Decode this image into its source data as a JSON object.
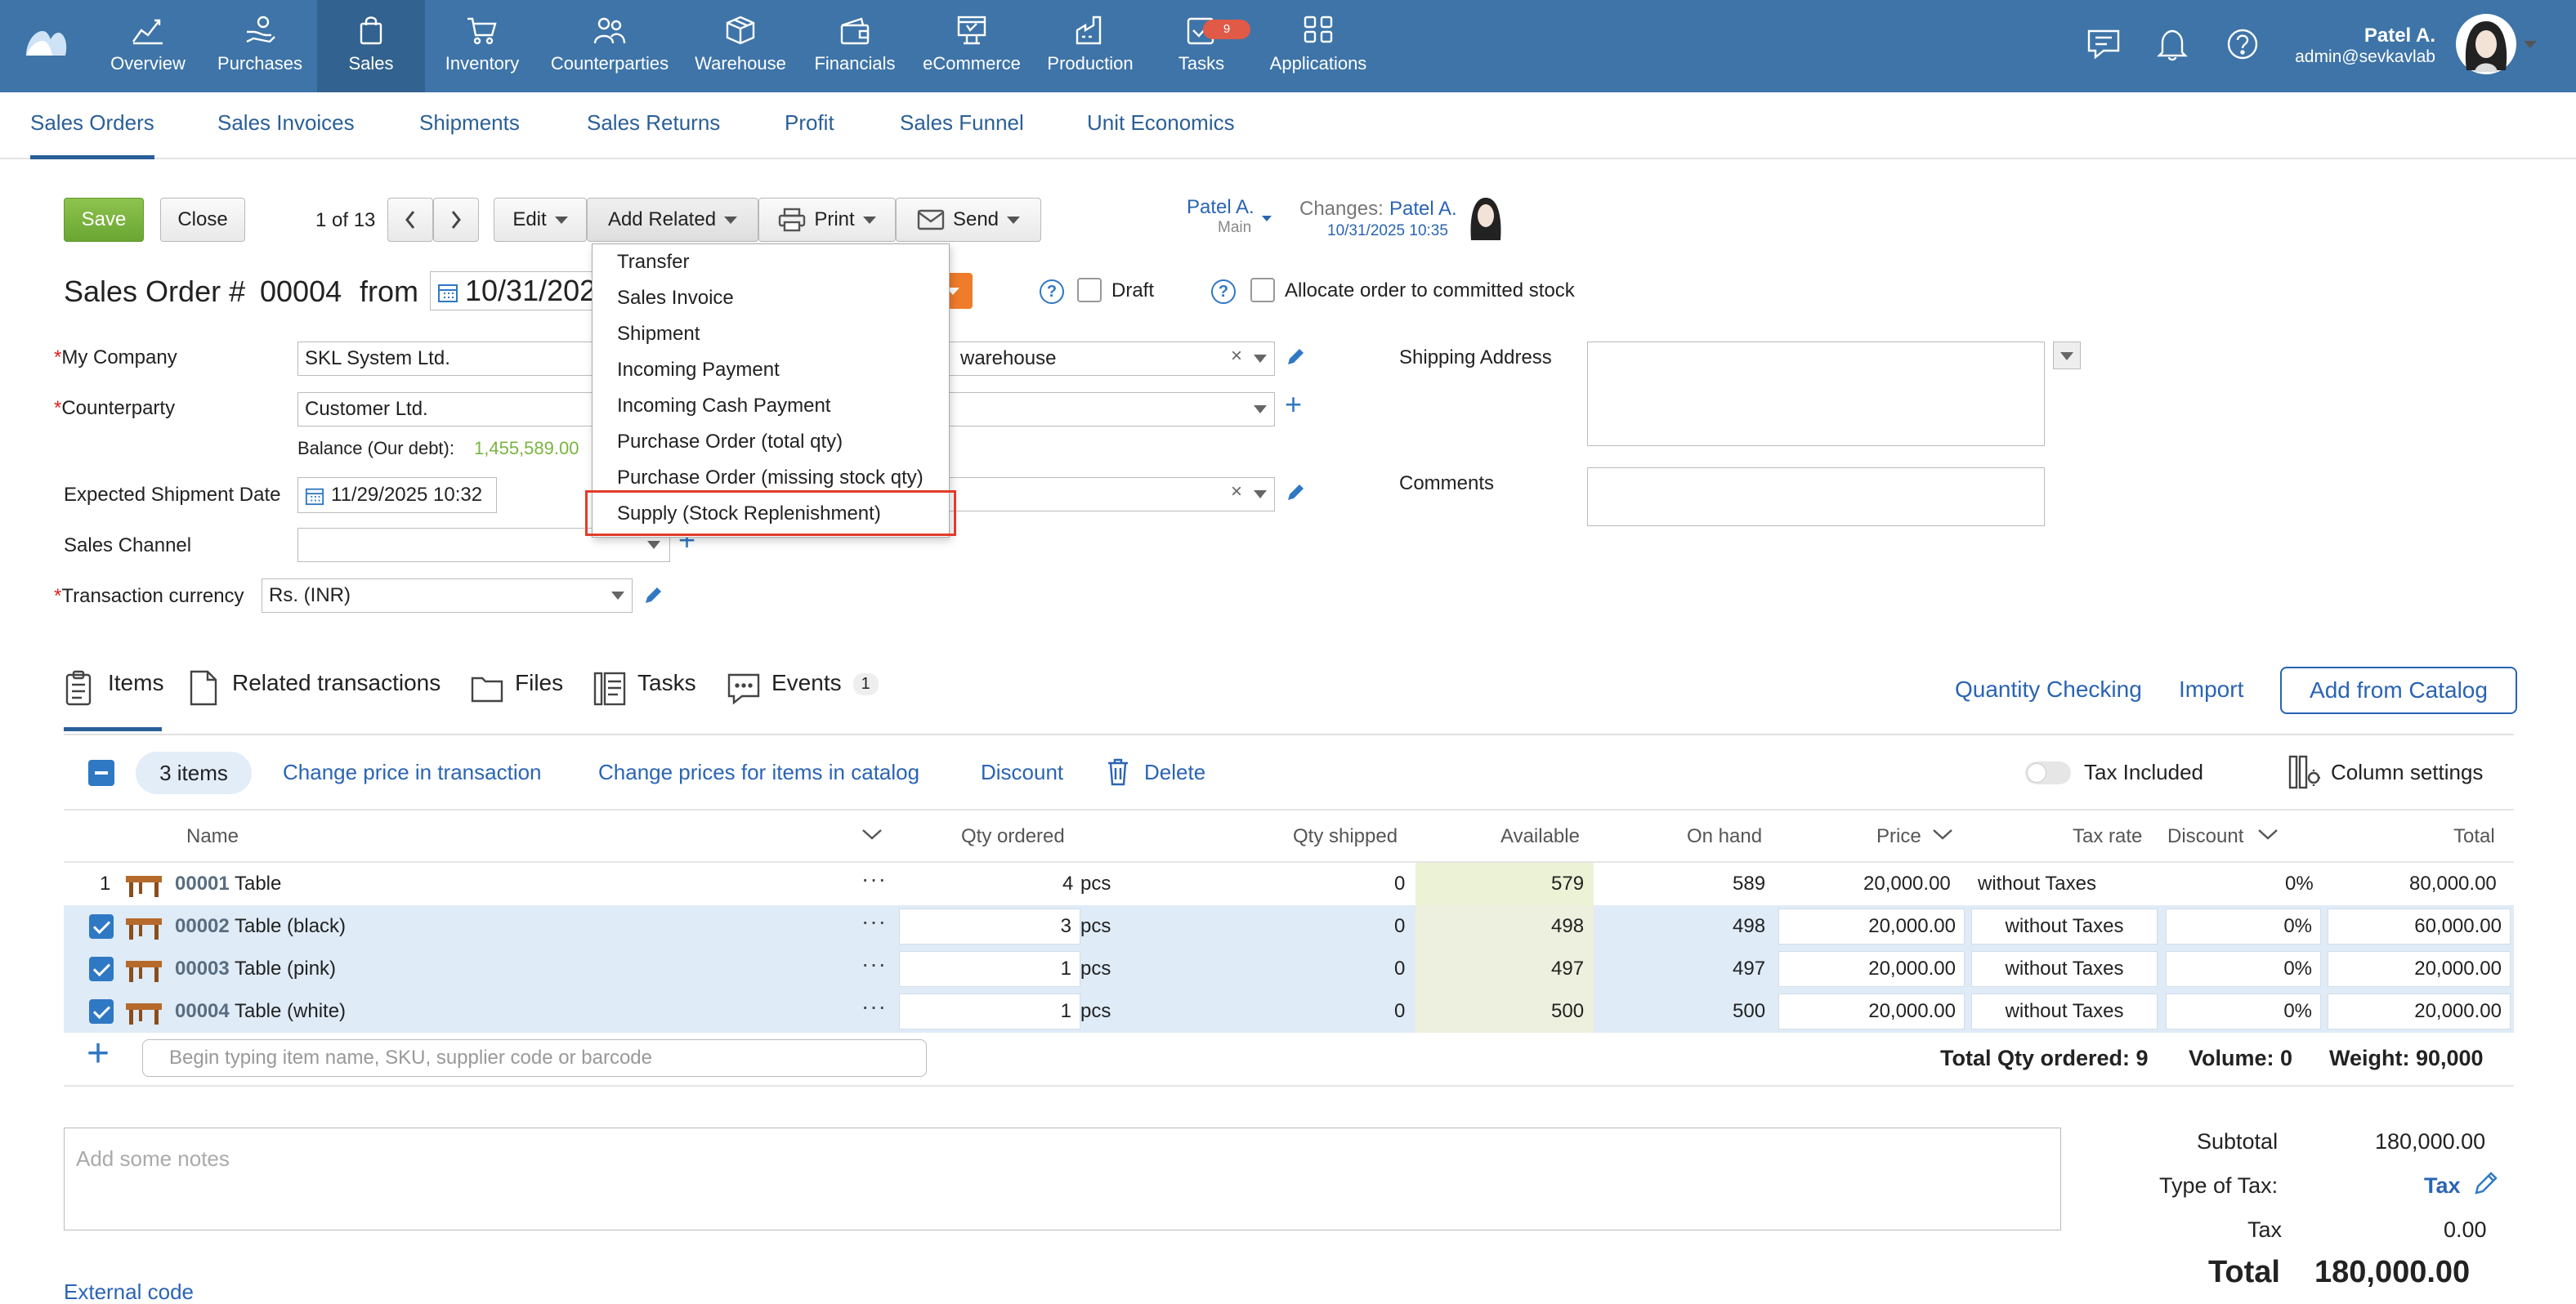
{
  "nav": {
    "items": [
      {
        "label": "Overview",
        "icon": "chart-line-icon"
      },
      {
        "label": "Purchases",
        "icon": "hand-money-icon"
      },
      {
        "label": "Sales",
        "icon": "shopping-bag-icon"
      },
      {
        "label": "Inventory",
        "icon": "cart-icon"
      },
      {
        "label": "Counterparties",
        "icon": "people-icon"
      },
      {
        "label": "Warehouse",
        "icon": "box-icon"
      },
      {
        "label": "Financials",
        "icon": "wallet-icon"
      },
      {
        "label": "eCommerce",
        "icon": "storefront-icon"
      },
      {
        "label": "Production",
        "icon": "factory-icon"
      },
      {
        "label": "Tasks",
        "icon": "checkmark-icon"
      },
      {
        "label": "Applications",
        "icon": "apps-grid-icon"
      }
    ],
    "tasks_badge": "9",
    "user_name": "Patel A.",
    "user_email": "admin@sevkavlab"
  },
  "subnav": {
    "tabs": [
      "Sales Orders",
      "Sales Invoices",
      "Shipments",
      "Sales Returns",
      "Profit",
      "Sales Funnel",
      "Unit Economics"
    ]
  },
  "toolbar": {
    "save": "Save",
    "close": "Close",
    "pager": "1 of 13",
    "edit": "Edit",
    "add_related": "Add Related",
    "print": "Print",
    "send": "Send",
    "owner": "Patel A.",
    "owner_sub": "Main",
    "changes_label": "Changes:",
    "changes_user": "Patel A.",
    "changes_date": "10/31/2025 10:35"
  },
  "menu": {
    "items": [
      "Transfer",
      "Sales Invoice",
      "Shipment",
      "Incoming Payment",
      "Incoming Cash Payment",
      "Purchase Order (total qty)",
      "Purchase Order (missing stock qty)",
      "Supply (Stock Replenishment)"
    ]
  },
  "header": {
    "title_prefix": "Sales Order #",
    "number": "00004",
    "from": "from",
    "date": "10/31/202",
    "draft": "Draft",
    "allocate": "Allocate order to committed stock"
  },
  "form": {
    "my_company_label": "My Company",
    "my_company": "SKL System Ltd.",
    "counterparty_label": "Counterparty",
    "counterparty": "Customer Ltd.",
    "balance_label": "Balance (Our debt):",
    "balance_value": "1,455,589.00",
    "warehouse": "warehouse",
    "exp_ship_label": "Expected Shipment Date",
    "exp_ship": "11/29/2025 10:32",
    "sales_channel_label": "Sales Channel",
    "currency_label": "Transaction currency",
    "currency": "Rs. (INR)",
    "shipping_label": "Shipping Address",
    "comments_label": "Comments"
  },
  "tabs": {
    "items": "Items",
    "related": "Related transactions",
    "files": "Files",
    "tasks": "Tasks",
    "events": "Events",
    "events_count": "1",
    "qty_check": "Quantity Checking",
    "import": "Import",
    "add_catalog": "Add from Catalog"
  },
  "actions": {
    "count": "3 items",
    "change_price": "Change price in transaction",
    "change_catalog": "Change prices for items in catalog",
    "discount": "Discount",
    "delete": "Delete",
    "tax_included": "Tax Included",
    "column_settings": "Column settings"
  },
  "columns": [
    "Name",
    "Qty ordered",
    "Qty shipped",
    "Available",
    "On hand",
    "Price",
    "Tax rate",
    "Discount",
    "Total"
  ],
  "rows": [
    {
      "n": "1",
      "code": "00001",
      "name": "Table",
      "qty": "4",
      "unit": "pcs",
      "shipped": "0",
      "available": "579",
      "onhand": "589",
      "price": "20,000.00",
      "tax": "without Taxes",
      "discount": "0%",
      "total": "80,000.00"
    },
    {
      "n": "",
      "code": "00002",
      "name": "Table (black)",
      "qty": "3",
      "unit": "pcs",
      "shipped": "0",
      "available": "498",
      "onhand": "498",
      "price": "20,000.00",
      "tax": "without Taxes",
      "discount": "0%",
      "total": "60,000.00"
    },
    {
      "n": "",
      "code": "00003",
      "name": "Table (pink)",
      "qty": "1",
      "unit": "pcs",
      "shipped": "0",
      "available": "497",
      "onhand": "497",
      "price": "20,000.00",
      "tax": "without Taxes",
      "discount": "0%",
      "total": "20,000.00"
    },
    {
      "n": "",
      "code": "00004",
      "name": "Table (white)",
      "qty": "1",
      "unit": "pcs",
      "shipped": "0",
      "available": "500",
      "onhand": "500",
      "price": "20,000.00",
      "tax": "without Taxes",
      "discount": "0%",
      "total": "20,000.00"
    }
  ],
  "add_item_placeholder": "Begin typing item name, SKU, supplier code or barcode",
  "totals_bar": {
    "qty": "Total Qty ordered: 9",
    "volume": "Volume: 0",
    "weight": "Weight: 90,000"
  },
  "notes_placeholder": "Add some notes",
  "external_code": "External code",
  "totals": {
    "subtotal_label": "Subtotal",
    "subtotal": "180,000.00",
    "type_tax_label": "Type of Tax:",
    "type_tax": "Tax",
    "tax_label": "Tax",
    "tax": "0.00",
    "total_label": "Total",
    "total": "180,000.00"
  },
  "colors": {
    "nav": "#3e74a8",
    "link": "#2a64b4",
    "save": "#7ab540",
    "available_bg": "#ecf2d6",
    "selected_row": "#dfebf7"
  }
}
